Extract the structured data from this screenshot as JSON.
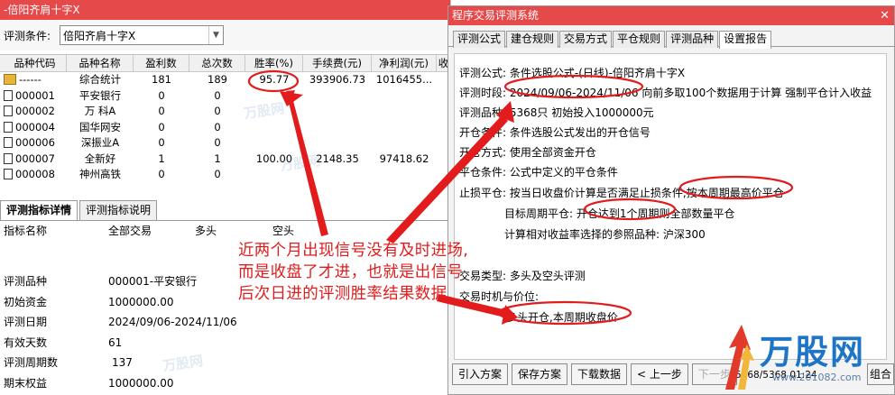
{
  "left": {
    "title": "-倍阳齐肩十字X",
    "filter_label": "评测条件:",
    "filter_value": "倍阳齐肩十字X",
    "columns": [
      "品种代码",
      "品种名称",
      "盈利数",
      "总次数",
      "胜率(%)",
      "手续费(元)",
      "净利润(元)",
      "收"
    ],
    "rows": [
      {
        "code": "------",
        "name": "综合统计",
        "win": "181",
        "total": "189",
        "rate": "95.77",
        "fee": "393906.73",
        "profit": "1016455..."
      },
      {
        "code": "000001",
        "name": "平安银行",
        "win": "0",
        "total": "0",
        "rate": "",
        "fee": "",
        "profit": ""
      },
      {
        "code": "000002",
        "name": "万 科A",
        "win": "0",
        "total": "0",
        "rate": "",
        "fee": "",
        "profit": ""
      },
      {
        "code": "000004",
        "name": "国华网安",
        "win": "0",
        "total": "0",
        "rate": "",
        "fee": "",
        "profit": ""
      },
      {
        "code": "000006",
        "name": "深振业A",
        "win": "0",
        "total": "0",
        "rate": "",
        "fee": "",
        "profit": ""
      },
      {
        "code": "000007",
        "name": "全新好",
        "win": "1",
        "total": "1",
        "rate": "100.00",
        "fee": "2148.35",
        "profit": "97418.62"
      },
      {
        "code": "000008",
        "name": "神州高铁",
        "win": "0",
        "total": "0",
        "rate": "",
        "fee": "",
        "profit": ""
      }
    ],
    "tabs": [
      "评测指标详情",
      "评测指标说明"
    ],
    "metrics_header": [
      "指标名称",
      "全部交易",
      "多头",
      "空头"
    ],
    "metrics": [
      {
        "k": "评测品种",
        "v": "000001-平安银行"
      },
      {
        "k": "初始资金",
        "v": "1000000.00"
      },
      {
        "k": "评测日期",
        "v": "2024/09/06-2024/11/06"
      },
      {
        "k": "有效天数",
        "v": "61"
      },
      {
        "k": "评测周期数",
        "v": "137"
      },
      {
        "k": "期末权益",
        "v": "1000000.00"
      }
    ]
  },
  "right": {
    "title": "程序交易评测系统",
    "tabs": [
      "评测公式",
      "建仓规则",
      "交易方式",
      "平仓规则",
      "评测品种",
      "设置报告"
    ],
    "lines": [
      {
        "k": "评测公式:",
        "v": "条件选股公式-(日线)-倍阳齐肩十字X"
      },
      {
        "k": "评测时段:",
        "v": "2024/09/06-2024/11/06 向前多取100个数据用于计算 强制平仓计入收益"
      },
      {
        "k": "评测品种:",
        "v": "5368只 初始投入1000000元"
      },
      {
        "k": "开仓条件:",
        "v": "条件选股公式发出的开仓信号"
      },
      {
        "k": "开仓方式:",
        "v": "使用全部资金开仓"
      },
      {
        "k": "平仓条件:",
        "v": "公式中定义的平仓条件"
      },
      {
        "k": "止损平仓:",
        "v": "按当日收盘价计算是否满足止损条件,按本周期最高价平仓"
      },
      {
        "k": "目标周期平仓:",
        "v": "开仓达到1个周期则全部数量平仓"
      },
      {
        "k": "",
        "v": "计算相对收益率选择的参照品种: 沪深300"
      },
      {
        "k": "交易类型:",
        "v": "多头及空头评测"
      },
      {
        "k": "交易时机与价位:",
        "v": ""
      },
      {
        "k": "",
        "v": "多头开仓,本周期收盘价"
      }
    ],
    "buttons": [
      "引入方案",
      "保存方案",
      "下载数据",
      "< 上一步",
      "下一步",
      "组合"
    ],
    "status": "5368/5368 01:24"
  },
  "annotation": [
    "近两个月出现信号没有及时进场,",
    "而是收盘了才进，也就是出信号",
    "后次日进的评测胜率结果数据"
  ],
  "logo": {
    "text": "万股网",
    "url": "www.201082.com"
  },
  "watermark": "万股网",
  "colors": {
    "title_bar": "#e64949",
    "annotation": "#e21c1c",
    "logo": "#1e74c6"
  }
}
